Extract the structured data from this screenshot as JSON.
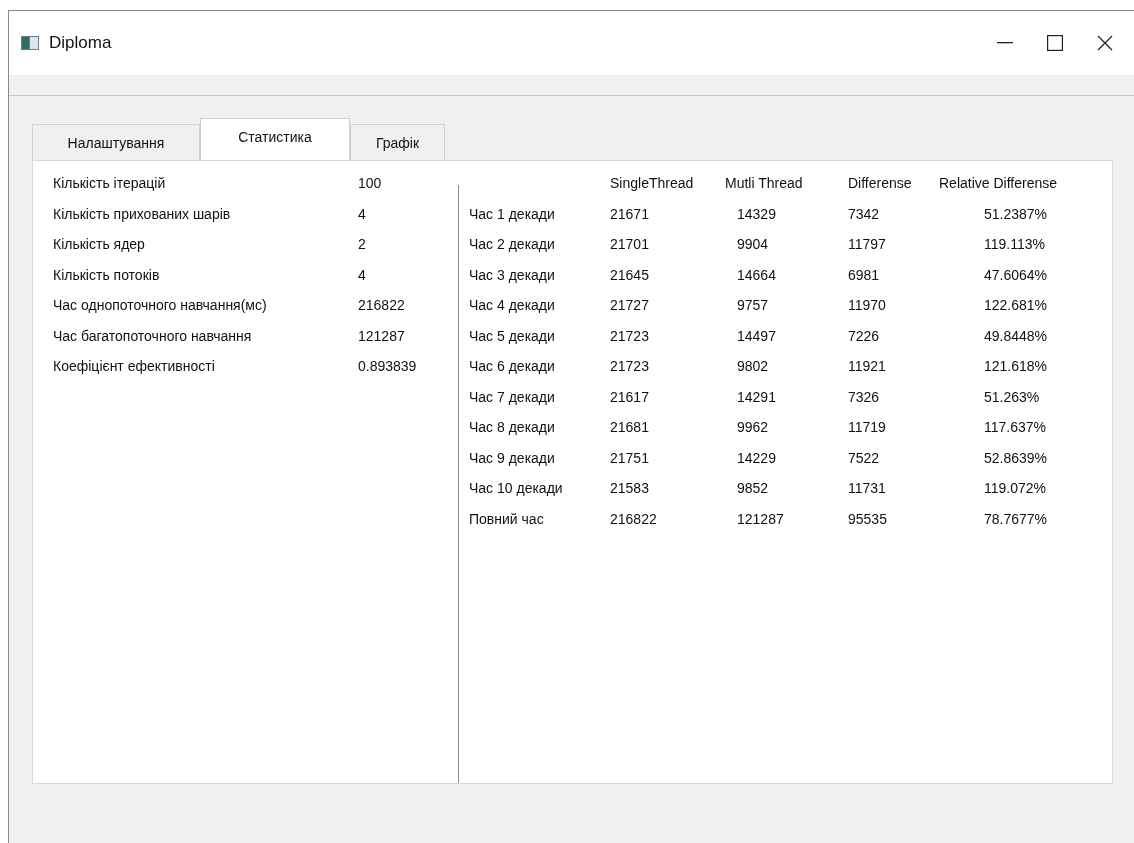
{
  "window": {
    "title": "Diploma"
  },
  "tabs": [
    {
      "label": "Налаштування",
      "selected": false
    },
    {
      "label": "Статистика",
      "selected": true
    },
    {
      "label": "Графік",
      "selected": false
    }
  ],
  "summary": [
    {
      "label": "Кількість ітерацій",
      "value": "100"
    },
    {
      "label": "Кількість прихованих шарів",
      "value": "4"
    },
    {
      "label": "Кількість ядер",
      "value": "2"
    },
    {
      "label": "Кількість потоків",
      "value": "4"
    },
    {
      "label": "Час однопоточного навчання(мс)",
      "value": "216822"
    },
    {
      "label": "Час багатопоточного навчання",
      "value": "121287"
    },
    {
      "label": "Коефіцієнт ефективності",
      "value": "0.893839"
    }
  ],
  "table": {
    "columns": [
      "SingleThread",
      "Mutli Thread",
      "Differense",
      "Relative Differense"
    ],
    "rows": [
      {
        "label": "Час 1 декади",
        "cells": [
          "21671",
          "14329",
          "7342",
          "51.2387%"
        ]
      },
      {
        "label": "Час 2 декади",
        "cells": [
          "21701",
          "9904",
          "11797",
          "119.113%"
        ]
      },
      {
        "label": "Час 3 декади",
        "cells": [
          "21645",
          "14664",
          "6981",
          "47.6064%"
        ]
      },
      {
        "label": "Час 4 декади",
        "cells": [
          "21727",
          "9757",
          "11970",
          "122.681%"
        ]
      },
      {
        "label": "Час 5 декади",
        "cells": [
          "21723",
          "14497",
          "7226",
          "49.8448%"
        ]
      },
      {
        "label": "Час 6 декади",
        "cells": [
          "21723",
          "9802",
          "11921",
          "121.618%"
        ]
      },
      {
        "label": "Час 7 декади",
        "cells": [
          "21617",
          "14291",
          "7326",
          "51.263%"
        ]
      },
      {
        "label": "Час 8 декади",
        "cells": [
          "21681",
          "9962",
          "11719",
          "117.637%"
        ]
      },
      {
        "label": "Час 9 декади",
        "cells": [
          "21751",
          "14229",
          "7522",
          "52.8639%"
        ]
      },
      {
        "label": "Час 10 декади",
        "cells": [
          "21583",
          "9852",
          "11731",
          "119.072%"
        ]
      },
      {
        "label": "Повний час",
        "cells": [
          "216822",
          "121287",
          "95535",
          "78.7677%"
        ]
      }
    ]
  }
}
